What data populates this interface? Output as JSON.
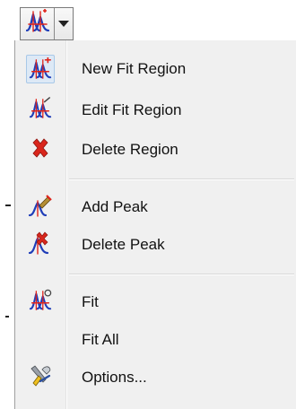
{
  "toolbar": {
    "split_button_icon": "fit-region-icon",
    "dropdown_icon": "dropdown-triangle-icon"
  },
  "menu": {
    "items": [
      {
        "label": "New Fit Region",
        "icon": "new-fit-region-icon"
      },
      {
        "label": "Edit Fit Region",
        "icon": "edit-fit-region-icon"
      },
      {
        "label": "Delete Region",
        "icon": "delete-region-icon"
      },
      {
        "label": "Add Peak",
        "icon": "add-peak-icon"
      },
      {
        "label": "Delete Peak",
        "icon": "delete-peak-icon"
      },
      {
        "label": "Fit",
        "icon": "fit-icon"
      },
      {
        "label": "Fit All",
        "icon": ""
      },
      {
        "label": "Options...",
        "icon": "options-icon"
      }
    ]
  },
  "colors": {
    "menu_bg": "#f0f0f0",
    "highlight_bg": "#dde9f6",
    "highlight_border": "#a8c8e8",
    "peak_red": "#e0241b",
    "peak_blue": "#1f3db8"
  }
}
